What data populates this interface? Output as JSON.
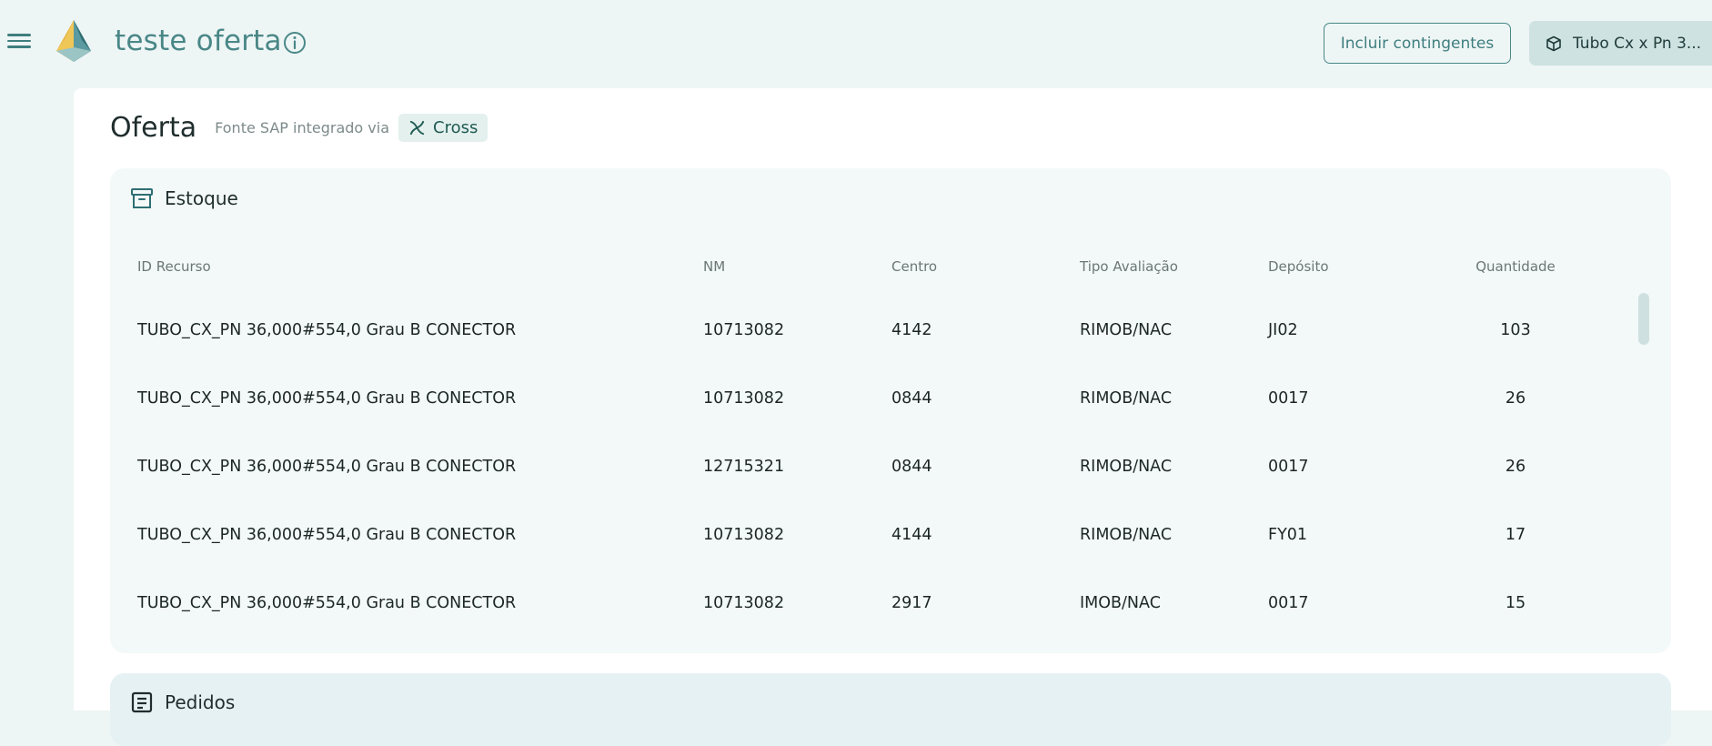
{
  "header": {
    "app_title": "teste oferta",
    "contingent_button": "Incluir contingentes",
    "product_button": "Tubo Cx x Pn 3..."
  },
  "page": {
    "title": "Oferta",
    "source_label": "Fonte SAP integrado via",
    "source_badge": "Cross"
  },
  "stock": {
    "title": "Estoque",
    "columns": [
      "ID Recurso",
      "NM",
      "Centro",
      "Tipo Avaliação",
      "Depósito",
      "Quantidade"
    ],
    "rows": [
      {
        "id": "TUBO_CX_PN 36,000#554,0 Grau B CONECTOR",
        "nm": "10713082",
        "centro": "4142",
        "tipo": "RIMOB/NAC",
        "deposito": "JI02",
        "quantidade": "103"
      },
      {
        "id": "TUBO_CX_PN 36,000#554,0 Grau B CONECTOR",
        "nm": "10713082",
        "centro": "0844",
        "tipo": "RIMOB/NAC",
        "deposito": "0017",
        "quantidade": "26"
      },
      {
        "id": "TUBO_CX_PN 36,000#554,0 Grau B CONECTOR",
        "nm": "12715321",
        "centro": "0844",
        "tipo": "RIMOB/NAC",
        "deposito": "0017",
        "quantidade": "26"
      },
      {
        "id": "TUBO_CX_PN 36,000#554,0 Grau B CONECTOR",
        "nm": "10713082",
        "centro": "4144",
        "tipo": "RIMOB/NAC",
        "deposito": "FY01",
        "quantidade": "17"
      },
      {
        "id": "TUBO_CX_PN 36,000#554,0 Grau B CONECTOR",
        "nm": "10713082",
        "centro": "2917",
        "tipo": "IMOB/NAC",
        "deposito": "0017",
        "quantidade": "15"
      }
    ]
  },
  "orders": {
    "title": "Pedidos"
  },
  "icons": {
    "menu": "menu-icon",
    "logo": "pyramid-logo",
    "info": "info-icon",
    "product": "cube-icon",
    "cross": "pinwheel-icon",
    "stock": "archive-box-icon",
    "orders": "order-list-icon"
  },
  "colors": {
    "accent": "#4a8787",
    "background": "#eef5f5",
    "card": "#f3f8f8",
    "badge_bg": "#e3f0ee"
  }
}
